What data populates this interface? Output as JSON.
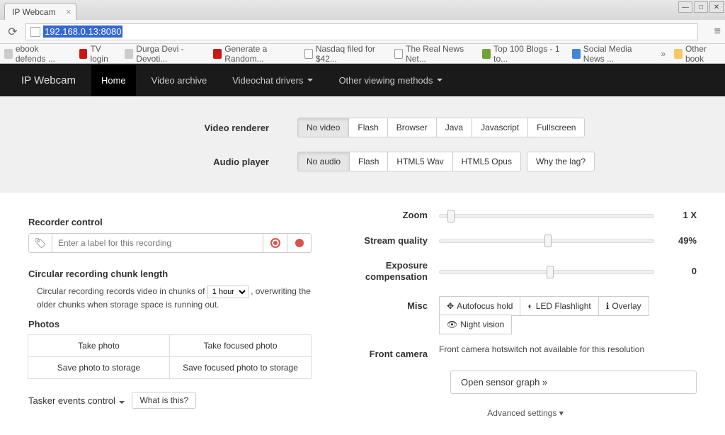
{
  "browser": {
    "tab_title": "IP Webcam",
    "url_highlighted": "192.168.0.13:8080",
    "bookmarks": [
      "ebook defends ...",
      "TV login",
      "Durga Devi - Devoti...",
      "Generate a Random...",
      "Nasdaq filed for $42...",
      "The Real News Net...",
      "Top 100 Blogs - 1 to...",
      "Social Media News ..."
    ],
    "bookmarks_more": "»",
    "other_bookmarks": "Other book"
  },
  "navbar": {
    "brand": "IP Webcam",
    "items": [
      "Home",
      "Video archive",
      "Videochat drivers",
      "Other viewing methods"
    ]
  },
  "video_renderer": {
    "label": "Video renderer",
    "options": [
      "No video",
      "Flash",
      "Browser",
      "Java",
      "Javascript",
      "Fullscreen"
    ]
  },
  "audio_player": {
    "label": "Audio player",
    "options": [
      "No audio",
      "Flash",
      "HTML5 Wav",
      "HTML5 Opus"
    ],
    "extra": "Why the lag?"
  },
  "recorder": {
    "heading": "Recorder control",
    "placeholder": "Enter a label for this recording"
  },
  "circular": {
    "heading": "Circular recording chunk length",
    "pre": "Circular recording records video in chunks of",
    "select": "1 hour",
    "post": ", overwriting the older chunks when storage space is running out."
  },
  "photos": {
    "heading": "Photos",
    "buttons": [
      "Take photo",
      "Take focused photo",
      "Save photo to storage",
      "Save focused photo to storage"
    ]
  },
  "tasker": {
    "label": "Tasker events control",
    "btn": "What is this?"
  },
  "sliders": {
    "zoom": {
      "label": "Zoom",
      "value": "1 X",
      "pos": 4
    },
    "quality": {
      "label": "Stream quality",
      "value": "49%",
      "pos": 49
    },
    "exposure": {
      "label": "Exposure compensation",
      "value": "0",
      "pos": 50
    }
  },
  "misc": {
    "label": "Misc",
    "buttons": [
      "Autofocus hold",
      "LED Flashlight",
      "Overlay",
      "Night vision"
    ]
  },
  "front": {
    "label": "Front camera",
    "text": "Front camera hotswitch not available for this resolution"
  },
  "sensor_btn": "Open sensor graph »",
  "advanced": "Advanced settings"
}
